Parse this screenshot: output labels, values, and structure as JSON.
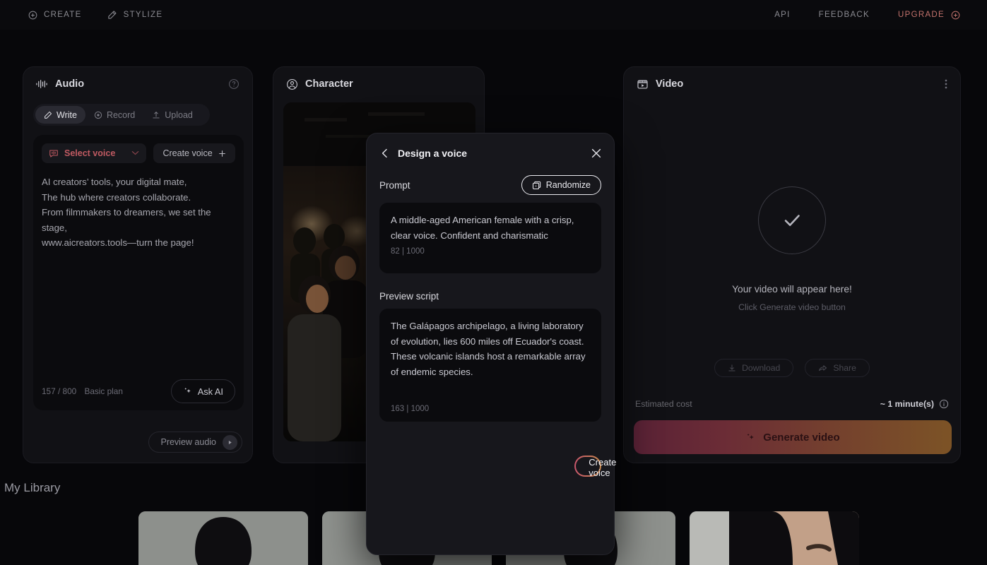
{
  "topbar": {
    "left_items": [
      {
        "label": "CREATE",
        "icon": "plus-circle-icon"
      },
      {
        "label": "STYLIZE",
        "icon": "magic-wand-icon"
      }
    ],
    "right_items": [
      {
        "label": "API",
        "icon": ""
      },
      {
        "label": "FEEDBACK",
        "icon": ""
      },
      {
        "label": "UPGRADE",
        "icon": "plus-circle-icon"
      }
    ],
    "upgrade_color": "#c4736d"
  },
  "audio_panel": {
    "title": "Audio",
    "help_icon": "question-circle-icon",
    "tabs": [
      {
        "label": "Write",
        "icon": "pencil-icon",
        "active": true
      },
      {
        "label": "Record",
        "icon": "record-dot-icon",
        "active": false
      },
      {
        "label": "Upload",
        "icon": "upload-icon",
        "active": false
      }
    ],
    "select_voice_label": "Select voice",
    "create_voice_label": "Create voice",
    "script": "AI creators’ tools, your digital mate,\nThe hub where creators collaborate.\nFrom filmmakers to dreamers, we set the stage,\nwww.aicreators.tools—turn the page!",
    "counter": "157 / 800",
    "plan": "Basic plan",
    "ask_ai_label": "Ask AI",
    "preview_audio_label": "Preview audio"
  },
  "character_panel": {
    "title": "Character",
    "icon": "user-circle-icon",
    "image_description": "dark concert crowd scene"
  },
  "video_panel": {
    "title": "Video",
    "icon": "video-clapper-icon",
    "menu_icon": "kebab-menu-icon",
    "status_icon": "check-circle-icon",
    "placeholder_title": "Your video will appear here!",
    "placeholder_subtitle": "Click Generate video button",
    "download_label": "Download",
    "share_label": "Share",
    "estimated_cost_label": "Estimated cost",
    "estimated_time": "~ 1 minute(s)",
    "info_icon": "info-circle-icon",
    "generate_label": "Generate video",
    "generate_gradient_from": "#5a2236",
    "generate_gradient_to": "#7c5326"
  },
  "modal": {
    "back_icon": "chevron-left-icon",
    "title": "Design a voice",
    "close_icon": "close-icon",
    "prompt_label": "Prompt",
    "randomize_label": "Randomize",
    "randomize_icon": "dice-icon",
    "prompt_text": "A middle-aged American female with a crisp, clear voice. Confident and charismatic",
    "prompt_count": "82 | 1000",
    "preview_script_label": "Preview script",
    "preview_script_text": "The Galápagos archipelago, a living laboratory of evolution, lies 600 miles off Ecuador's coast. These volcanic islands host a remarkable array of endemic species.",
    "preview_script_count": "163 | 1000",
    "create_voice_label": "Create voice",
    "cta_gradient_from": "#c8566c",
    "cta_gradient_to": "#c98a4e"
  },
  "library": {
    "title": "My Library",
    "items": [
      {
        "alt": "portrait thumbnail 1"
      },
      {
        "alt": "portrait thumbnail 2"
      },
      {
        "alt": "portrait thumbnail 3"
      },
      {
        "alt": "portrait thumbnail 4"
      }
    ]
  }
}
